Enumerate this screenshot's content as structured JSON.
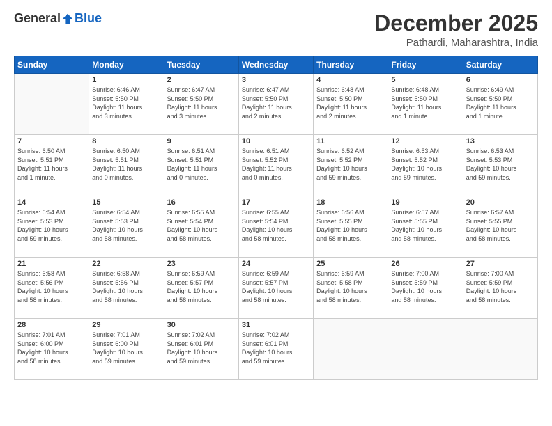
{
  "header": {
    "logo_general": "General",
    "logo_blue": "Blue",
    "month_title": "December 2025",
    "subtitle": "Pathardi, Maharashtra, India"
  },
  "weekdays": [
    "Sunday",
    "Monday",
    "Tuesday",
    "Wednesday",
    "Thursday",
    "Friday",
    "Saturday"
  ],
  "weeks": [
    [
      {
        "day": "",
        "info": ""
      },
      {
        "day": "1",
        "info": "Sunrise: 6:46 AM\nSunset: 5:50 PM\nDaylight: 11 hours\nand 3 minutes."
      },
      {
        "day": "2",
        "info": "Sunrise: 6:47 AM\nSunset: 5:50 PM\nDaylight: 11 hours\nand 3 minutes."
      },
      {
        "day": "3",
        "info": "Sunrise: 6:47 AM\nSunset: 5:50 PM\nDaylight: 11 hours\nand 2 minutes."
      },
      {
        "day": "4",
        "info": "Sunrise: 6:48 AM\nSunset: 5:50 PM\nDaylight: 11 hours\nand 2 minutes."
      },
      {
        "day": "5",
        "info": "Sunrise: 6:48 AM\nSunset: 5:50 PM\nDaylight: 11 hours\nand 1 minute."
      },
      {
        "day": "6",
        "info": "Sunrise: 6:49 AM\nSunset: 5:50 PM\nDaylight: 11 hours\nand 1 minute."
      }
    ],
    [
      {
        "day": "7",
        "info": "Sunrise: 6:50 AM\nSunset: 5:51 PM\nDaylight: 11 hours\nand 1 minute."
      },
      {
        "day": "8",
        "info": "Sunrise: 6:50 AM\nSunset: 5:51 PM\nDaylight: 11 hours\nand 0 minutes."
      },
      {
        "day": "9",
        "info": "Sunrise: 6:51 AM\nSunset: 5:51 PM\nDaylight: 11 hours\nand 0 minutes."
      },
      {
        "day": "10",
        "info": "Sunrise: 6:51 AM\nSunset: 5:52 PM\nDaylight: 11 hours\nand 0 minutes."
      },
      {
        "day": "11",
        "info": "Sunrise: 6:52 AM\nSunset: 5:52 PM\nDaylight: 10 hours\nand 59 minutes."
      },
      {
        "day": "12",
        "info": "Sunrise: 6:53 AM\nSunset: 5:52 PM\nDaylight: 10 hours\nand 59 minutes."
      },
      {
        "day": "13",
        "info": "Sunrise: 6:53 AM\nSunset: 5:53 PM\nDaylight: 10 hours\nand 59 minutes."
      }
    ],
    [
      {
        "day": "14",
        "info": "Sunrise: 6:54 AM\nSunset: 5:53 PM\nDaylight: 10 hours\nand 59 minutes."
      },
      {
        "day": "15",
        "info": "Sunrise: 6:54 AM\nSunset: 5:53 PM\nDaylight: 10 hours\nand 58 minutes."
      },
      {
        "day": "16",
        "info": "Sunrise: 6:55 AM\nSunset: 5:54 PM\nDaylight: 10 hours\nand 58 minutes."
      },
      {
        "day": "17",
        "info": "Sunrise: 6:55 AM\nSunset: 5:54 PM\nDaylight: 10 hours\nand 58 minutes."
      },
      {
        "day": "18",
        "info": "Sunrise: 6:56 AM\nSunset: 5:55 PM\nDaylight: 10 hours\nand 58 minutes."
      },
      {
        "day": "19",
        "info": "Sunrise: 6:57 AM\nSunset: 5:55 PM\nDaylight: 10 hours\nand 58 minutes."
      },
      {
        "day": "20",
        "info": "Sunrise: 6:57 AM\nSunset: 5:55 PM\nDaylight: 10 hours\nand 58 minutes."
      }
    ],
    [
      {
        "day": "21",
        "info": "Sunrise: 6:58 AM\nSunset: 5:56 PM\nDaylight: 10 hours\nand 58 minutes."
      },
      {
        "day": "22",
        "info": "Sunrise: 6:58 AM\nSunset: 5:56 PM\nDaylight: 10 hours\nand 58 minutes."
      },
      {
        "day": "23",
        "info": "Sunrise: 6:59 AM\nSunset: 5:57 PM\nDaylight: 10 hours\nand 58 minutes."
      },
      {
        "day": "24",
        "info": "Sunrise: 6:59 AM\nSunset: 5:57 PM\nDaylight: 10 hours\nand 58 minutes."
      },
      {
        "day": "25",
        "info": "Sunrise: 6:59 AM\nSunset: 5:58 PM\nDaylight: 10 hours\nand 58 minutes."
      },
      {
        "day": "26",
        "info": "Sunrise: 7:00 AM\nSunset: 5:59 PM\nDaylight: 10 hours\nand 58 minutes."
      },
      {
        "day": "27",
        "info": "Sunrise: 7:00 AM\nSunset: 5:59 PM\nDaylight: 10 hours\nand 58 minutes."
      }
    ],
    [
      {
        "day": "28",
        "info": "Sunrise: 7:01 AM\nSunset: 6:00 PM\nDaylight: 10 hours\nand 58 minutes."
      },
      {
        "day": "29",
        "info": "Sunrise: 7:01 AM\nSunset: 6:00 PM\nDaylight: 10 hours\nand 59 minutes."
      },
      {
        "day": "30",
        "info": "Sunrise: 7:02 AM\nSunset: 6:01 PM\nDaylight: 10 hours\nand 59 minutes."
      },
      {
        "day": "31",
        "info": "Sunrise: 7:02 AM\nSunset: 6:01 PM\nDaylight: 10 hours\nand 59 minutes."
      },
      {
        "day": "",
        "info": ""
      },
      {
        "day": "",
        "info": ""
      },
      {
        "day": "",
        "info": ""
      }
    ]
  ]
}
